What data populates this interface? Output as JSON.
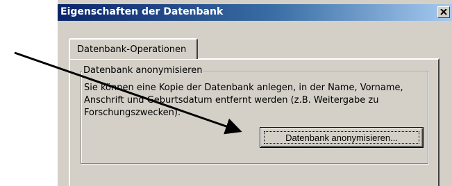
{
  "window": {
    "title": "Eigenschaften der Datenbank"
  },
  "tabs": [
    {
      "label": "Datenbank-Operationen"
    }
  ],
  "group": {
    "title": "Datenbank anonymisieren",
    "description_lines": [
      "Sie können eine Kopie der Datenbank anlegen, in der Name, Vorname,",
      "Anschrift und Geburtsdatum entfernt werden (z.B. Weitergabe zu",
      "Forschungszwecken)."
    ],
    "button_label": "Datenbank anonymisieren..."
  },
  "icons": {
    "close": "close-icon",
    "annotation": "annotation-arrow-icon"
  },
  "colors": {
    "titlebar_start": "#0a246a",
    "titlebar_end": "#a6caf0",
    "face": "#d4d0c8"
  }
}
